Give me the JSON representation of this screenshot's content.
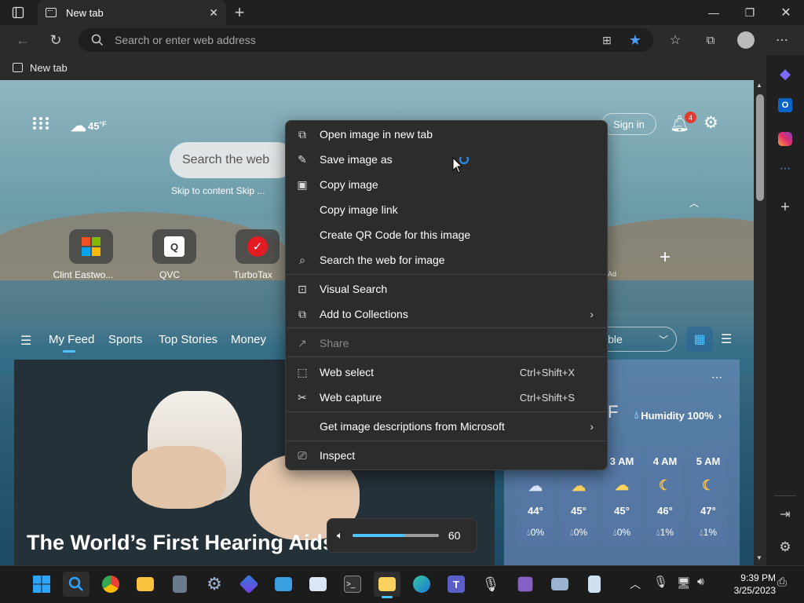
{
  "browser": {
    "tab_title": "New tab",
    "address_placeholder": "Search or enter web address",
    "bookmark_item": "New tab",
    "accent": "#4cc2ff"
  },
  "page": {
    "weather_temp": "45",
    "weather_unit": "°F",
    "search_placeholder": "Search the web",
    "skip_links": "Skip to content Skip ...",
    "sign_in": "Sign in",
    "notif_count": "4",
    "quick_links": [
      {
        "label": "Clint Eastwo...",
        "color": "#1a1a1a"
      },
      {
        "label": "QVC",
        "color": "#ffffff"
      },
      {
        "label": "TurboTax",
        "color": "#ffffff"
      }
    ],
    "ad_label": "Ad",
    "feed_tabs": [
      "My Feed",
      "Sports",
      "Top Stories",
      "Money"
    ],
    "feed_layout_label": "ible",
    "headline": "The World’s First Hearing Aids",
    "weather_card": {
      "unit_partial": "F",
      "humidity": "Humidity 100%",
      "hours": [
        {
          "time": "3 AM",
          "temp": "45°",
          "precip": "0%",
          "icon": "cloud-icon"
        },
        {
          "time": "4 AM",
          "temp": "46°",
          "precip": "1%",
          "icon": "moon-cloud-icon"
        },
        {
          "time": "5 AM",
          "temp": "47°",
          "precip": "1%",
          "icon": "moon-cloud-icon"
        }
      ],
      "partial_hours": [
        {
          "temp": "44°",
          "precip": "0%"
        },
        {
          "temp": "45°",
          "precip": "0%"
        }
      ]
    }
  },
  "context_menu": {
    "items": [
      {
        "label": "Open image in new tab",
        "icon": "new-tab-icon"
      },
      {
        "label": "Save image as",
        "icon": "save-icon"
      },
      {
        "label": "Copy image",
        "icon": "image-icon"
      },
      {
        "label": "Copy image link",
        "icon": ""
      },
      {
        "label": "Create QR Code for this image",
        "icon": ""
      },
      {
        "label": "Search the web for image",
        "icon": "image-search-icon"
      },
      {
        "label": "Visual Search",
        "icon": "visual-search-icon"
      },
      {
        "label": "Add to Collections",
        "icon": "collections-icon"
      },
      {
        "label": "Share",
        "icon": "share-icon"
      },
      {
        "label": "Web select",
        "icon": "web-select-icon",
        "shortcut": "Ctrl+Shift+X"
      },
      {
        "label": "Web capture",
        "icon": "web-capture-icon",
        "shortcut": "Ctrl+Shift+S"
      },
      {
        "label": "Get image descriptions from Microsoft",
        "icon": ""
      },
      {
        "label": "Inspect",
        "icon": "inspect-icon"
      }
    ]
  },
  "volume": {
    "level": "60",
    "fraction": 0.6
  },
  "taskbar": {
    "time": "9:39 PM",
    "date": "3/25/2023"
  }
}
